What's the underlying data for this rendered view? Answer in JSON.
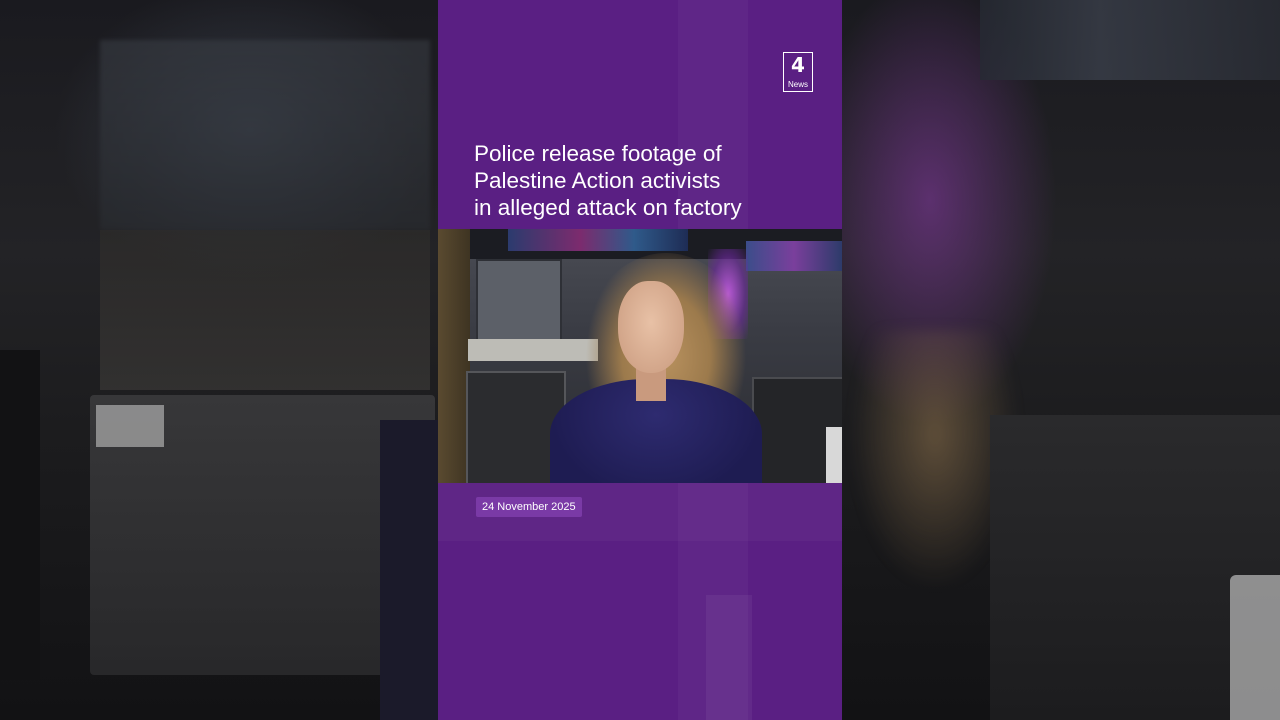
{
  "brand": {
    "logo_mark": "4",
    "logo_word": "News",
    "panel_color": "#5a1f83",
    "badge_color": "#7a3aa6"
  },
  "headline": {
    "lines": [
      "Police release footage of",
      "Palestine Action activists",
      "in alleged attack on factory"
    ]
  },
  "date_label": "24 November 2025",
  "icons": {
    "logo": "channel-4-news-logo"
  }
}
